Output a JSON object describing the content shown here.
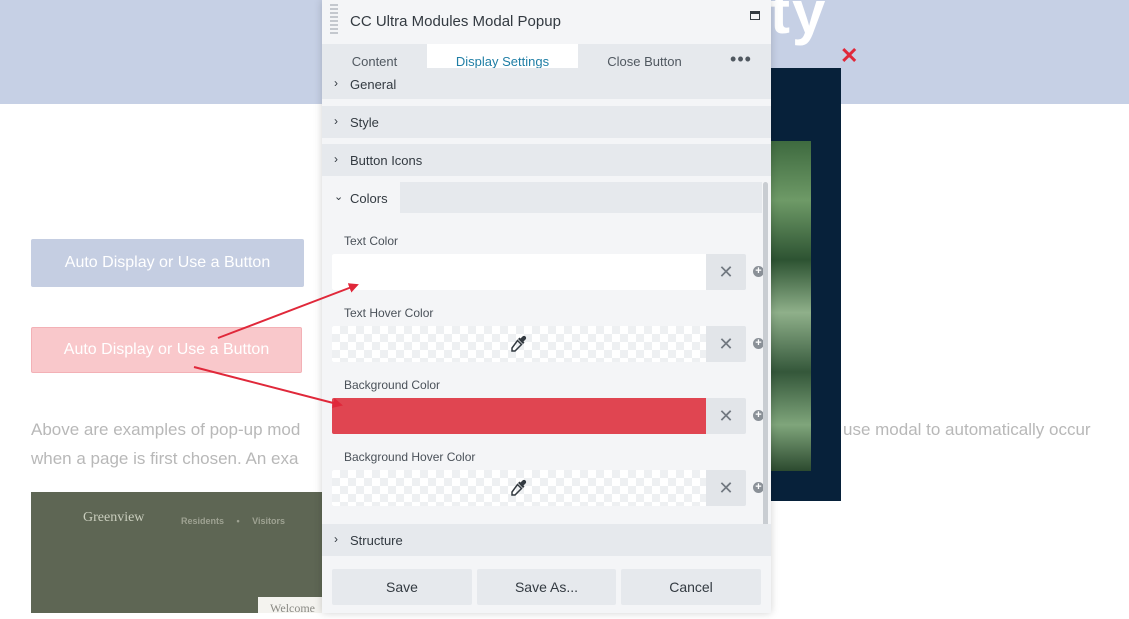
{
  "background": {
    "hero_glyphs": "ty",
    "button_primary": "Auto Display or Use a Button",
    "button_secondary": "Auto Display or Use a Button",
    "paragraph_left_line1": "Above are examples of pop-up mod",
    "paragraph_left_line2": "when a page is first chosen.  An exa",
    "paragraph_right": "use modal to automatically occur",
    "image_logo": "Greenview",
    "image_nav": "Residents • Visitors",
    "welcome_text": "Welcome"
  },
  "modal_preview": {
    "close_glyph": "✕"
  },
  "panel": {
    "title": "CC Ultra Modules Modal Popup",
    "tabs": [
      {
        "label": "Content"
      },
      {
        "label": "Display Settings",
        "active": true
      },
      {
        "label": "Close Button"
      },
      {
        "label": "•••"
      }
    ],
    "sections": {
      "general": "General",
      "style": "Style",
      "button_icons": "Button Icons",
      "colors": "Colors",
      "structure": "Structure"
    },
    "fields": [
      {
        "label": "Text Color",
        "swatch": "#ffffff"
      },
      {
        "label": "Text Hover Color",
        "swatch": "transparent"
      },
      {
        "label": "Background Color",
        "swatch": "#e04551"
      },
      {
        "label": "Background Hover Color",
        "swatch": "transparent"
      }
    ],
    "footer": {
      "save": "Save",
      "save_as": "Save As...",
      "cancel": "Cancel"
    }
  },
  "icons": {
    "chevron_right": "›",
    "chevron_down": "⌄",
    "clear": "✕",
    "plus": "+"
  },
  "colors": {
    "accent": "#1f7ea5",
    "annotation_arrow": "#e0283a",
    "hero": "#c6d0e5"
  }
}
